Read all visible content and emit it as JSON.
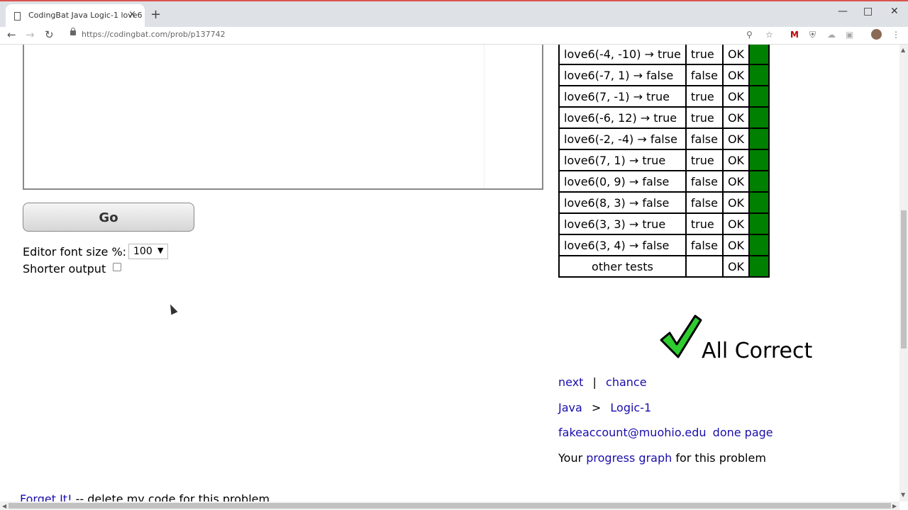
{
  "browser": {
    "tab_title": "CodingBat Java Logic-1 love6",
    "url": "https://codingbat.com/prob/p137742",
    "new_tab": "+",
    "close_tab": "×"
  },
  "form": {
    "go_label": "Go",
    "font_size_label": "Editor font size %:",
    "font_size_value": "100",
    "shorter_output_label": "Shorter output",
    "shorter_output_checked": false
  },
  "results": [
    {
      "expected": "love6(-4, -10) → true",
      "run": "true",
      "status": "OK"
    },
    {
      "expected": "love6(-7, 1) → false",
      "run": "false",
      "status": "OK"
    },
    {
      "expected": "love6(7, -1) → true",
      "run": "true",
      "status": "OK"
    },
    {
      "expected": "love6(-6, 12) → true",
      "run": "true",
      "status": "OK"
    },
    {
      "expected": "love6(-2, -4) → false",
      "run": "false",
      "status": "OK"
    },
    {
      "expected": "love6(7, 1) → true",
      "run": "true",
      "status": "OK"
    },
    {
      "expected": "love6(0, 9) → false",
      "run": "false",
      "status": "OK"
    },
    {
      "expected": "love6(8, 3) → false",
      "run": "false",
      "status": "OK"
    },
    {
      "expected": "love6(3, 3) → true",
      "run": "true",
      "status": "OK"
    },
    {
      "expected": "love6(3, 4) → false",
      "run": "false",
      "status": "OK"
    },
    {
      "expected": "other tests",
      "run": "",
      "status": "OK"
    }
  ],
  "status_color": "#008000",
  "all_correct": "All Correct",
  "nav_links": {
    "next": "next",
    "separator": "|",
    "chance": "chance",
    "lang": "Java",
    "arrow": ">",
    "section": "Logic-1",
    "account": "fakeaccount@muohio.edu",
    "done_page": "done page",
    "your": "Your",
    "progress_graph": "progress graph",
    "for_problem": "for this problem"
  },
  "forget": {
    "link": "Forget It!",
    "text": " -- delete my code for this problem"
  }
}
